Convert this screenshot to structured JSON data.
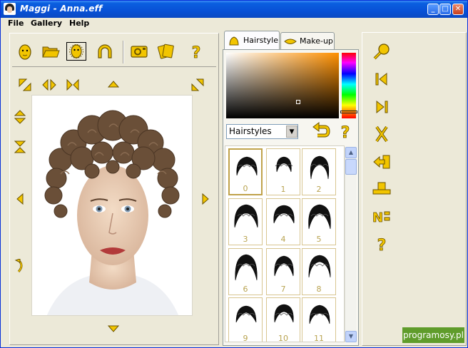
{
  "window": {
    "title": "Maggi - Anna.eff",
    "controls": [
      "minimize",
      "maximize",
      "close"
    ]
  },
  "menu": {
    "items": [
      "File",
      "Gallery",
      "Help"
    ]
  },
  "toolbar": {
    "icons": [
      "face-icon",
      "open-folder-icon",
      "head-outline-icon",
      "arch-icon",
      "camera-icon",
      "cards-icon",
      "help-icon"
    ]
  },
  "tabs": [
    {
      "label": "Hairstyle",
      "active": true
    },
    {
      "label": "Make-up",
      "active": false
    }
  ],
  "hairstyle_panel": {
    "category": "Hairstyles",
    "thumbnails": [
      "0",
      "1",
      "2",
      "3",
      "4",
      "5",
      "6",
      "7",
      "8",
      "9",
      "10",
      "11"
    ],
    "selected_index": 0
  },
  "right_tools": {
    "icons": [
      "zoom-icon",
      "first-icon",
      "last-icon",
      "cut-icon",
      "insert-icon",
      "stamp-icon",
      "number-icon",
      "help-icon"
    ]
  },
  "watermark": "programosy.pl",
  "colors": {
    "titlebar": "#0851d6",
    "accent": "#f2c500",
    "window_bg": "#ece9d8"
  }
}
